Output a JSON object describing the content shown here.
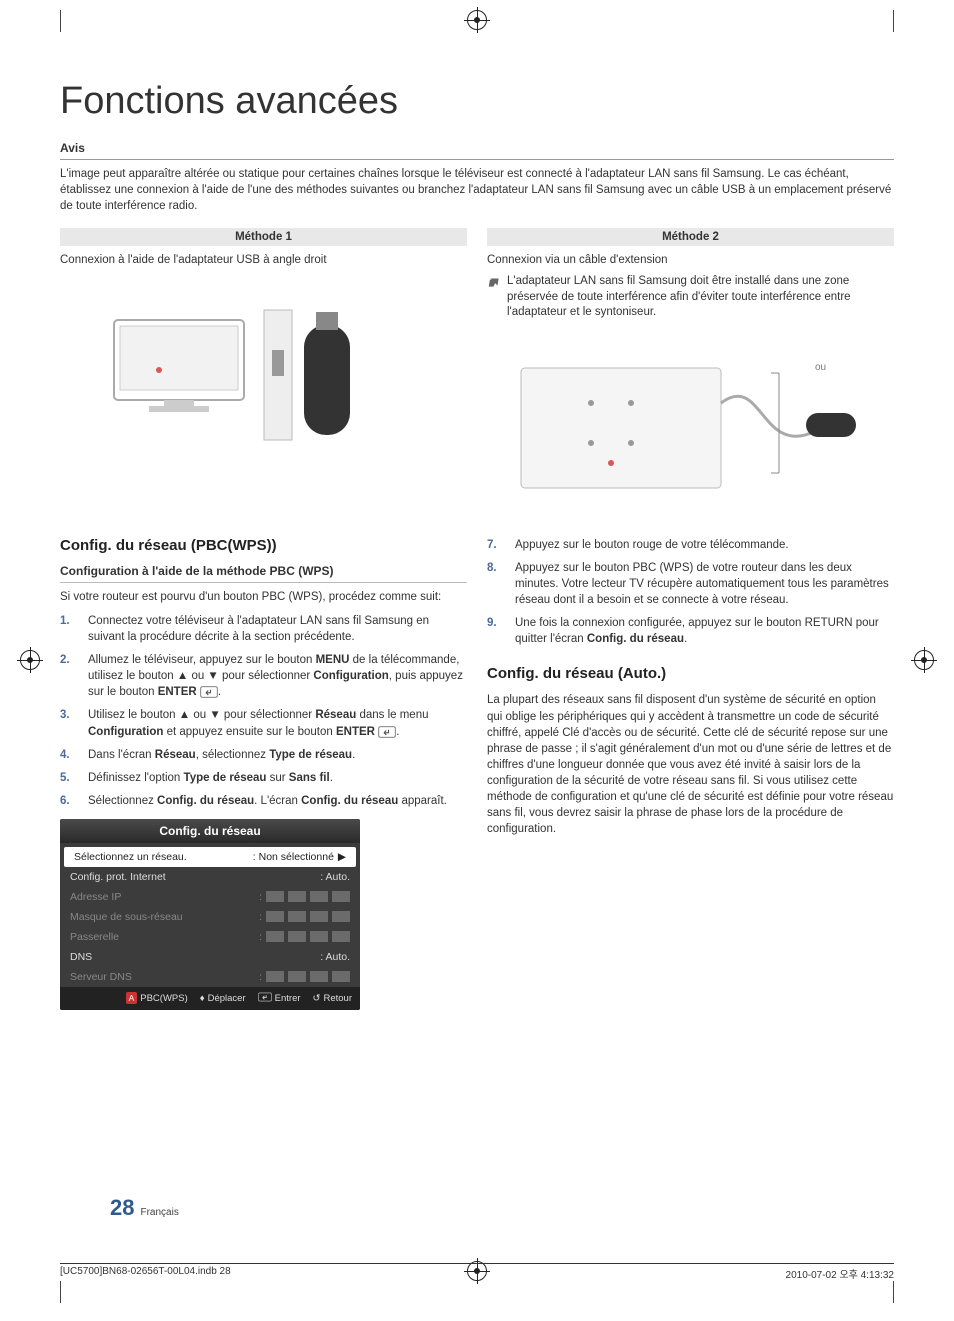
{
  "title": "Fonctions avancées",
  "avis": {
    "heading": "Avis",
    "body": "L'image peut apparaître altérée ou statique pour certaines chaînes lorsque le téléviseur est connecté à l'adaptateur LAN sans fil Samsung. Le cas échéant, établissez une connexion à l'aide de l'une des méthodes suivantes ou branchez l'adaptateur LAN sans fil Samsung avec un câble USB à un emplacement préservé de toute interférence radio."
  },
  "methods": {
    "m1": {
      "head": "Méthode 1",
      "caption": "Connexion à l'aide de l'adaptateur USB à angle droit"
    },
    "m2": {
      "head": "Méthode 2",
      "caption": "Connexion via un câble d'extension",
      "note": "L'adaptateur LAN sans fil Samsung doit être installé dans une zone préservée de toute interférence afin d'éviter toute interférence entre l'adaptateur et le syntoniseur.",
      "ou": "ou"
    }
  },
  "left": {
    "h2": "Config. du réseau (PBC(WPS))",
    "h3": "Configuration à l'aide de la méthode PBC (WPS)",
    "intro": "Si votre routeur est pourvu d'un bouton PBC (WPS), procédez comme suit:",
    "steps": [
      "Connectez votre téléviseur à l'adaptateur LAN sans fil Samsung en suivant la procédure décrite à la section précédente.",
      "Allumez le téléviseur, appuyez sur le bouton MENU de la télécommande, utilisez le bouton ▲ ou ▼ pour sélectionner Configuration, puis appuyez sur le bouton ENTER",
      "Utilisez le bouton ▲ ou ▼ pour sélectionner Réseau dans le menu Configuration et appuyez ensuite sur le bouton ENTER",
      "Dans l'écran Réseau, sélectionnez Type de réseau.",
      "Définissez l'option Type de réseau sur Sans fil.",
      "Sélectionnez Config. du réseau. L'écran Config. du réseau apparaît."
    ],
    "step_nums": [
      "1.",
      "2.",
      "3.",
      "4.",
      "5.",
      "6."
    ],
    "menu_word": "MENU",
    "config_word": "Configuration",
    "reseau_word": "Réseau",
    "type_word": "Type de réseau",
    "sansfil_word": "Sans fil",
    "cfg_word": "Config. du réseau",
    "enter_word": "ENTER"
  },
  "osd": {
    "title": "Config. du réseau",
    "rows": {
      "sel_label": "Sélectionnez un réseau.",
      "sel_value": ": Non sélectionné",
      "prot_label": "Config. prot. Internet",
      "prot_value": ": Auto.",
      "ip_label": "Adresse IP",
      "mask_label": "Masque de sous-réseau",
      "gw_label": "Passerelle",
      "dns_label": "DNS",
      "dns_value": ": Auto.",
      "dnssrv_label": "Serveur DNS"
    },
    "footer": {
      "pbc": "PBC(WPS)",
      "move": "Déplacer",
      "enter": "Entrer",
      "return": "Retour"
    }
  },
  "right": {
    "cont_start": 7,
    "steps": [
      "Appuyez sur le bouton rouge de votre télécommande.",
      "Appuyez sur le bouton PBC (WPS) de votre routeur dans les deux minutes. Votre lecteur TV récupère automatiquement tous les paramètres réseau dont il a besoin et se connecte à votre réseau.",
      "Une fois la connexion configurée, appuyez sur le bouton RETURN pour quitter l'écran Config. du réseau."
    ],
    "step_nums": [
      "7.",
      "8.",
      "9."
    ],
    "h2b": "Config. du réseau (Auto.)",
    "parab": "La plupart des réseaux sans fil disposent d'un système de sécurité en option qui oblige les périphériques qui y accèdent à transmettre un code de sécurité chiffré, appelé Clé d'accès ou de sécurité. Cette clé de sécurité repose sur une phrase de passe ; il s'agit généralement d'un mot ou d'une série de lettres et de chiffres d'une longueur donnée que vous avez été invité à saisir lors de la configuration de la sécurité de votre réseau sans fil. Si vous utilisez cette méthode de configuration et qu'une clé de sécurité est définie pour votre réseau sans fil, vous devrez saisir la phrase de phase lors de la procédure de configuration."
  },
  "footer": {
    "page": "28",
    "lang": "Français"
  },
  "printmeta": {
    "left": "[UC5700]BN68-02656T-00L04.indb   28",
    "right": "2010-07-02   오후 4:13:32"
  }
}
